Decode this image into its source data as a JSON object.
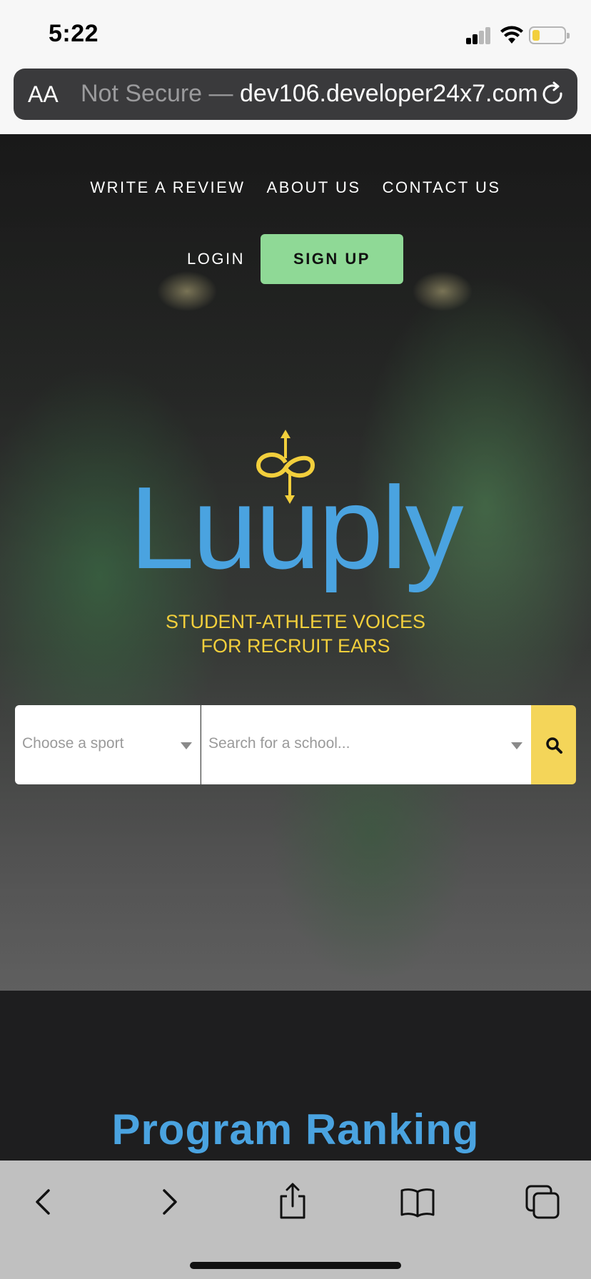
{
  "status_bar": {
    "time": "5:22",
    "icons": [
      "signal-icon",
      "wifi-icon",
      "battery-icon"
    ],
    "battery_color": "#f2cf3c"
  },
  "browser": {
    "text_size_label": "AA",
    "url_prefix": "Not Secure — ",
    "url_host": "dev106.developer24x7.com",
    "icons": [
      "reload-icon"
    ]
  },
  "nav": {
    "items": [
      "WRITE A REVIEW",
      "ABOUT US",
      "CONTACT US"
    ],
    "login_label": "LOGIN",
    "signup_label": "SIGN UP",
    "signup_color": "#8fd996"
  },
  "hero": {
    "logo_text": "Luuply",
    "logo_color": "#4aa3e0",
    "tagline_line1": "STUDENT-ATHLETE VOICES",
    "tagline_line2": "FOR RECRUIT EARS",
    "tagline_color": "#f2cf3c"
  },
  "search": {
    "sport_placeholder": "Choose a sport",
    "school_placeholder": "Search for a school...",
    "button_color": "#f4d559",
    "icons": [
      "search-icon"
    ]
  },
  "ranking": {
    "title": "Program Ranking"
  },
  "toolbar": {
    "icons": [
      "back-icon",
      "forward-icon",
      "share-icon",
      "bookmarks-icon",
      "tabs-icon"
    ]
  }
}
